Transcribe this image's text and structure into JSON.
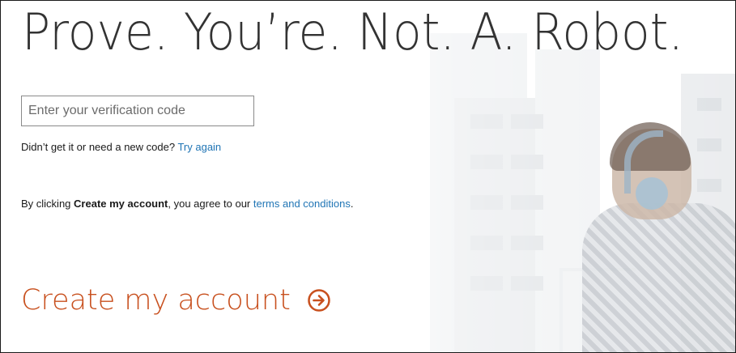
{
  "headline": "Prove. You’re. Not. A. Robot.",
  "verification": {
    "placeholder": "Enter your verification code",
    "value": ""
  },
  "resend": {
    "text": "Didn’t get it or need a new code?",
    "link_label": "Try again"
  },
  "terms": {
    "prefix": "By clicking",
    "bold": "Create my account",
    "middle": ", you agree to our",
    "link_label": "terms and conditions",
    "suffix": "."
  },
  "create_account": {
    "label": "Create my account",
    "icon": "arrow-circle-right-icon"
  },
  "colors": {
    "headline": "#333333",
    "link": "#2075b5",
    "accent": "#c8501e"
  }
}
